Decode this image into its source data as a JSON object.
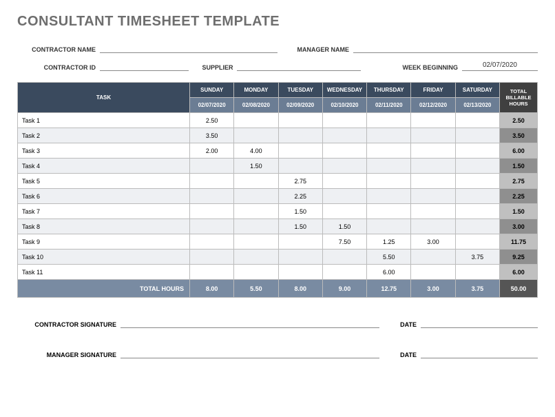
{
  "title": "CONSULTANT TIMESHEET TEMPLATE",
  "fields": {
    "contractor_name_label": "CONTRACTOR NAME",
    "manager_name_label": "MANAGER NAME",
    "contractor_id_label": "CONTRACTOR ID",
    "supplier_label": "SUPPLIER",
    "week_beginning_label": "WEEK BEGINNING",
    "week_beginning_value": "02/07/2020",
    "contractor_signature_label": "CONTRACTOR SIGNATURE",
    "manager_signature_label": "MANAGER SIGNATURE",
    "date_label": "DATE"
  },
  "headers": {
    "task": "TASK",
    "days": [
      "SUNDAY",
      "MONDAY",
      "TUESDAY",
      "WEDNESDAY",
      "THURSDAY",
      "FRIDAY",
      "SATURDAY"
    ],
    "dates": [
      "02/07/2020",
      "02/08/2020",
      "02/09/2020",
      "02/10/2020",
      "02/11/2020",
      "02/12/2020",
      "02/13/2020"
    ],
    "total_billable": "TOTAL BILLABLE HOURS",
    "total_hours": "TOTAL HOURS"
  },
  "rows": [
    {
      "task": "Task 1",
      "vals": [
        "2.50",
        "",
        "",
        "",
        "",
        "",
        ""
      ],
      "total": "2.50"
    },
    {
      "task": "Task 2",
      "vals": [
        "3.50",
        "",
        "",
        "",
        "",
        "",
        ""
      ],
      "total": "3.50"
    },
    {
      "task": "Task 3",
      "vals": [
        "2.00",
        "4.00",
        "",
        "",
        "",
        "",
        ""
      ],
      "total": "6.00"
    },
    {
      "task": "Task 4",
      "vals": [
        "",
        "1.50",
        "",
        "",
        "",
        "",
        ""
      ],
      "total": "1.50"
    },
    {
      "task": "Task 5",
      "vals": [
        "",
        "",
        "2.75",
        "",
        "",
        "",
        ""
      ],
      "total": "2.75"
    },
    {
      "task": "Task 6",
      "vals": [
        "",
        "",
        "2.25",
        "",
        "",
        "",
        ""
      ],
      "total": "2.25"
    },
    {
      "task": "Task 7",
      "vals": [
        "",
        "",
        "1.50",
        "",
        "",
        "",
        ""
      ],
      "total": "1.50"
    },
    {
      "task": "Task 8",
      "vals": [
        "",
        "",
        "1.50",
        "1.50",
        "",
        "",
        ""
      ],
      "total": "3.00"
    },
    {
      "task": "Task 9",
      "vals": [
        "",
        "",
        "",
        "7.50",
        "1.25",
        "3.00",
        ""
      ],
      "total": "11.75"
    },
    {
      "task": "Task 10",
      "vals": [
        "",
        "",
        "",
        "",
        "5.50",
        "",
        "3.75"
      ],
      "total": "9.25"
    },
    {
      "task": "Task 11",
      "vals": [
        "",
        "",
        "",
        "",
        "6.00",
        "",
        ""
      ],
      "total": "6.00"
    }
  ],
  "col_totals": [
    "8.00",
    "5.50",
    "8.00",
    "9.00",
    "12.75",
    "3.00",
    "3.75"
  ],
  "grand_total": "50.00"
}
